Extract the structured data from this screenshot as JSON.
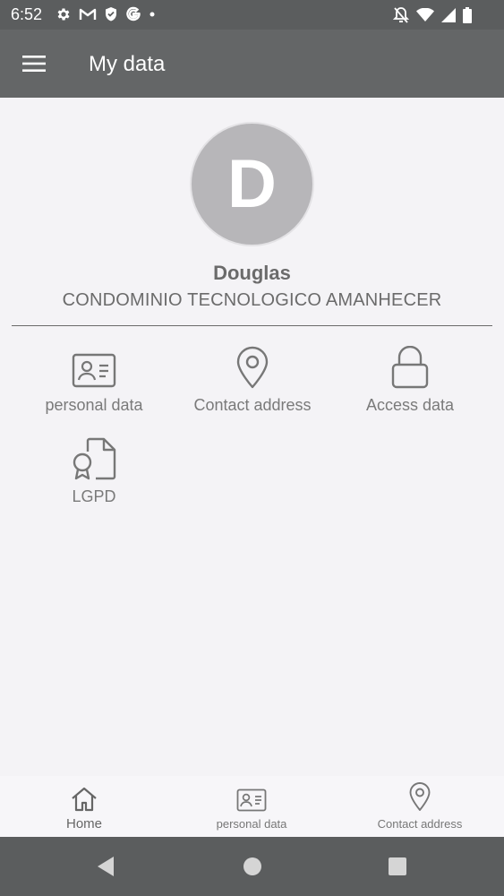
{
  "status_bar": {
    "time": "6:52",
    "left_icons": [
      "gear-icon",
      "gmail-icon",
      "shield-icon",
      "google-icon",
      "dot-icon"
    ],
    "right_icons": [
      "notifications-off-icon",
      "wifi-icon",
      "signal-icon",
      "battery-icon"
    ]
  },
  "app_bar": {
    "title": "My data",
    "menu_icon": "hamburger-menu-icon"
  },
  "profile": {
    "initial": "D",
    "name": "Douglas",
    "organization": "CONDOMINIO TECNOLOGICO AMANHECER"
  },
  "menu_items": [
    {
      "label": "personal data",
      "icon": "id-card-icon"
    },
    {
      "label": "Contact address",
      "icon": "location-pin-icon"
    },
    {
      "label": "Access data",
      "icon": "lock-icon"
    },
    {
      "label": "LGPD",
      "icon": "certificate-document-icon"
    }
  ],
  "bottom_nav": [
    {
      "label": "Home",
      "icon": "home-icon",
      "active": true
    },
    {
      "label": "personal data",
      "icon": "id-card-icon",
      "active": false
    },
    {
      "label": "Contact address",
      "icon": "location-pin-icon",
      "active": false
    }
  ],
  "system_nav": [
    "back-icon",
    "home-circle-icon",
    "recents-square-icon"
  ],
  "colors": {
    "app_bar": "#646667",
    "status_bar": "#5b5d5e",
    "background": "#f4f3f6",
    "avatar": "#b7b6b9",
    "icon_gray": "#777777"
  }
}
